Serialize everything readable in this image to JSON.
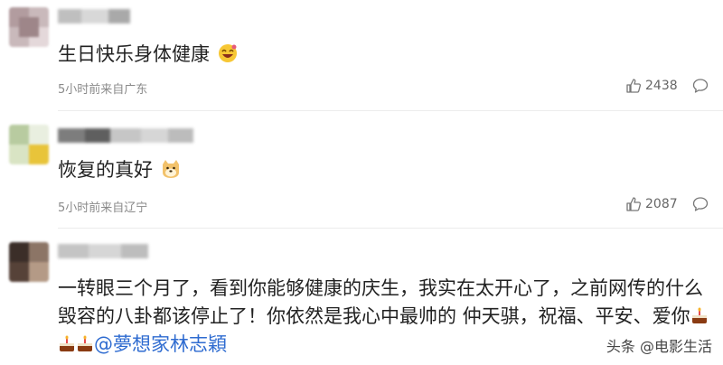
{
  "comments": [
    {
      "text": "生日快乐身体健康",
      "meta": "5小时前来自广东",
      "likes": "2438",
      "emoji": "laughing-emoji"
    },
    {
      "text": "恢复的真好",
      "meta": "5小时前来自辽宁",
      "likes": "2087",
      "emoji": "doge-emoji"
    },
    {
      "text_main": "一转眼三个月了，看到你能够健康的庆生，我实在太开心了，之前网传的什么毁容的八卦都该停止了！你依然是我心中最帅的 仲天骐，祝福、平安、爱你",
      "mention": "@夢想家林志穎",
      "emoji": "cake-emoji"
    }
  ],
  "watermark": "头条 @电影生活",
  "colors": {
    "mention": "#2e6bd0",
    "meta": "#8a8a8a",
    "text": "#222222"
  }
}
